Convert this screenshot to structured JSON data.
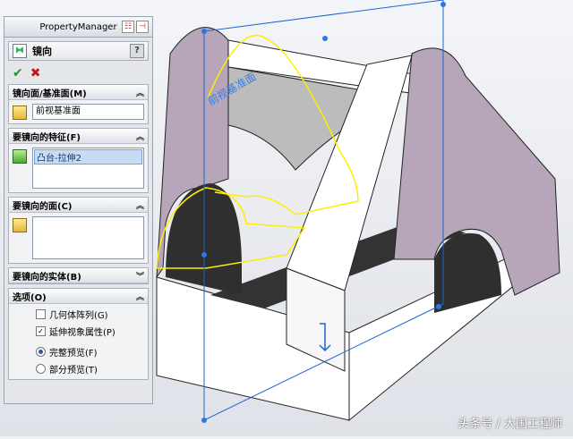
{
  "panel": {
    "header_title": "PropertyManager",
    "feature_title": "镜向",
    "help_label": "?",
    "groups": {
      "mirror_plane": {
        "title": "镜向面/基准面(M)",
        "value": "前视基准面"
      },
      "features": {
        "title": "要镜向的特征(F)",
        "items": [
          "凸台-拉伸2"
        ]
      },
      "faces": {
        "title": "要镜向的面(C)"
      },
      "bodies": {
        "title": "要镜向的实体(B)"
      },
      "options": {
        "title": "选项(O)",
        "geometry_pattern": "几何体阵列(G)",
        "geometry_pattern_checked": false,
        "propagate_visual": "延伸视象属性(P)",
        "propagate_visual_checked": true,
        "full_preview": "完整预览(F)",
        "partial_preview": "部分预览(T)",
        "preview_mode": "full"
      }
    }
  },
  "viewport": {
    "plane_label": "前视基准面"
  },
  "watermark": "头条号 / 大国工程师",
  "colors": {
    "body": "#b7a6b9",
    "accent": "#1e64d2",
    "preview": "#ffee00"
  }
}
